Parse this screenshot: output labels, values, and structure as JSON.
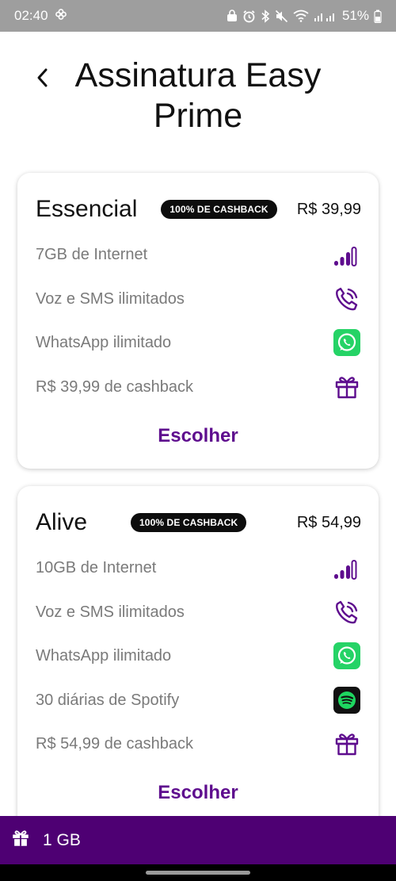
{
  "status_bar": {
    "time": "02:40",
    "battery": "51%"
  },
  "header": {
    "title": "Assinatura Easy Prime"
  },
  "plans": [
    {
      "name": "Essencial",
      "badge": "100% DE CASHBACK",
      "price": "R$ 39,99",
      "features": [
        {
          "label": "7GB de Internet",
          "icon": "signal-bars-icon"
        },
        {
          "label": "Voz e SMS ilimitados",
          "icon": "phone-call-icon"
        },
        {
          "label": "WhatsApp ilimitado",
          "icon": "whatsapp-icon"
        },
        {
          "label": "R$ 39,99 de cashback",
          "icon": "gift-icon"
        }
      ],
      "button": "Escolher"
    },
    {
      "name": "Alive",
      "badge": "100% DE CASHBACK",
      "price": "R$ 54,99",
      "features": [
        {
          "label": "10GB de Internet",
          "icon": "signal-bars-icon"
        },
        {
          "label": "Voz e SMS ilimitados",
          "icon": "phone-call-icon"
        },
        {
          "label": "WhatsApp ilimitado",
          "icon": "whatsapp-icon"
        },
        {
          "label": "30 diárias de Spotify",
          "icon": "spotify-icon"
        },
        {
          "label": "R$ 54,99 de cashback",
          "icon": "gift-icon"
        }
      ],
      "button": "Escolher"
    }
  ],
  "bottom_bar": {
    "label": "1 GB",
    "icon": "gift-icon"
  },
  "colors": {
    "brand_purple": "#5e0d8e",
    "bottom_bar": "#4e0073",
    "whatsapp_green": "#25d366",
    "badge_bg": "#0d0d0d"
  }
}
